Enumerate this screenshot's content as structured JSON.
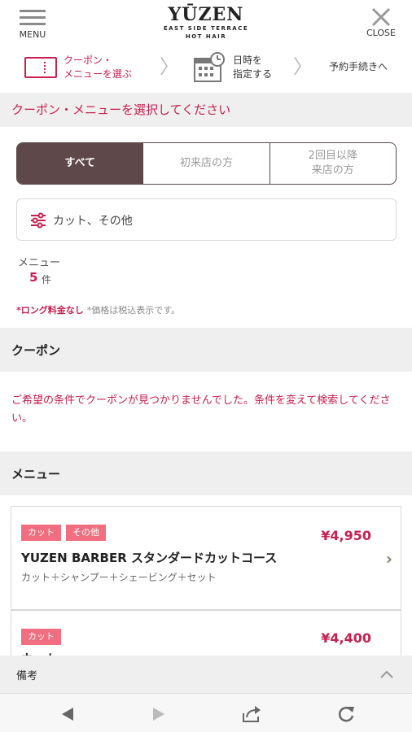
{
  "header": {
    "menu_label": "MENU",
    "logo_main": "YŪZEN",
    "logo_sub1": "EAST SIDE TERRACE",
    "logo_sub2": "HOT HAIR",
    "close_label": "CLOSE"
  },
  "steps": {
    "step1_line1": "クーポン・",
    "step1_line2": "メニューを選ぶ",
    "step2_line1": "日時を",
    "step2_line2": "指定する",
    "step3": "予約手続きへ"
  },
  "select_title": "クーポン・メニューを選択してください",
  "tabs": [
    {
      "label": "すべて"
    },
    {
      "label": "初来店の方"
    },
    {
      "label_line1": "2回目以降",
      "label_line2": "来店の方"
    }
  ],
  "search": {
    "text": "カット、その他"
  },
  "count": {
    "label": "メニュー",
    "value": "5",
    "unit": "件"
  },
  "notes": {
    "red": "*ロング料金なし",
    "gray": "*価格は税込表示です。"
  },
  "coupon_section": {
    "title": "クーポン",
    "message": "ご希望の条件でクーポンが見つかりませんでした。条件を変えて検索してください。"
  },
  "menu_section": {
    "title": "メニュー"
  },
  "menu_items": [
    {
      "tags": [
        "カット",
        "その他"
      ],
      "price": "¥4,950",
      "title": "YUZEN BARBER スタンダードカットコース",
      "subtitle": "カット＋シャンプー＋シェービング＋セット"
    },
    {
      "tags": [
        "カット"
      ],
      "price": "¥4,400",
      "title": "カット",
      "subtitle": ""
    }
  ],
  "remarks": {
    "label": "備考"
  },
  "colors": {
    "accent": "#c8204f",
    "tab_active": "#5e4849",
    "tag": "#f06e7f",
    "band": "#efefef"
  }
}
